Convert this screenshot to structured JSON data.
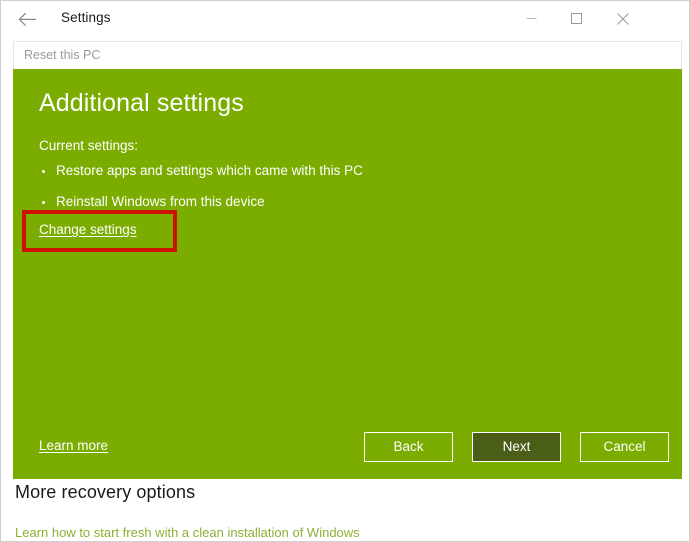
{
  "window": {
    "title": "Settings",
    "back_icon": "back-arrow-icon",
    "controls": {
      "minimize": "minimize-icon",
      "maximize": "maximize-icon",
      "close": "close-icon"
    }
  },
  "breadcrumb": {
    "text": "Reset this PC"
  },
  "panel": {
    "heading": "Additional settings",
    "current_settings_label": "Current settings:",
    "settings": [
      "Restore apps and settings which came with this PC",
      "Reinstall Windows from this device"
    ],
    "change_settings_link": "Change settings",
    "learn_more_link": "Learn more",
    "buttons": {
      "back": "Back",
      "next": "Next",
      "cancel": "Cancel"
    },
    "background_color": "#7AAD00",
    "next_button_color": "#4A5E18"
  },
  "annotation": {
    "color": "#CC1100",
    "target": "Change settings"
  },
  "footer": {
    "heading": "More recovery options",
    "link": "Learn how to start fresh with a clean installation of Windows",
    "link_color": "#8FAF35"
  }
}
